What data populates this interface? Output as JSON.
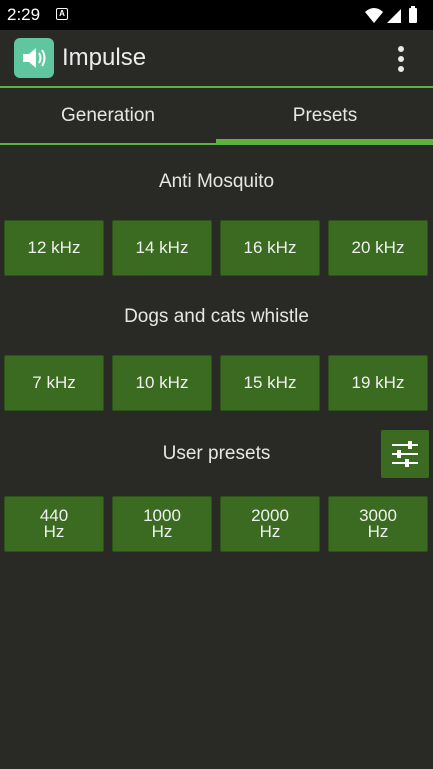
{
  "status": {
    "time": "2:29",
    "notification_glyph": "A"
  },
  "appbar": {
    "title": "Impulse",
    "icon": "speaker-icon",
    "menu_icon": "more-vert-icon"
  },
  "tabs": [
    {
      "label": "Generation",
      "active": false
    },
    {
      "label": "Presets",
      "active": true
    }
  ],
  "colors": {
    "background": "#292925",
    "accent": "#5db33e",
    "button": "#3a6b20"
  },
  "sections": {
    "mosquito": {
      "title": "Anti Mosquito",
      "buttons": [
        "12 kHz",
        "14 kHz",
        "16 kHz",
        "20 kHz"
      ]
    },
    "dogs": {
      "title": "Dogs and cats whistle",
      "buttons": [
        "7 kHz",
        "10 kHz",
        "15 kHz",
        "19 kHz"
      ]
    },
    "user": {
      "title": "User presets",
      "edit_icon": "sliders-icon",
      "buttons": [
        {
          "value": "440",
          "unit": "Hz"
        },
        {
          "value": "1000",
          "unit": "Hz"
        },
        {
          "value": "2000",
          "unit": "Hz"
        },
        {
          "value": "3000",
          "unit": "Hz"
        }
      ]
    }
  }
}
